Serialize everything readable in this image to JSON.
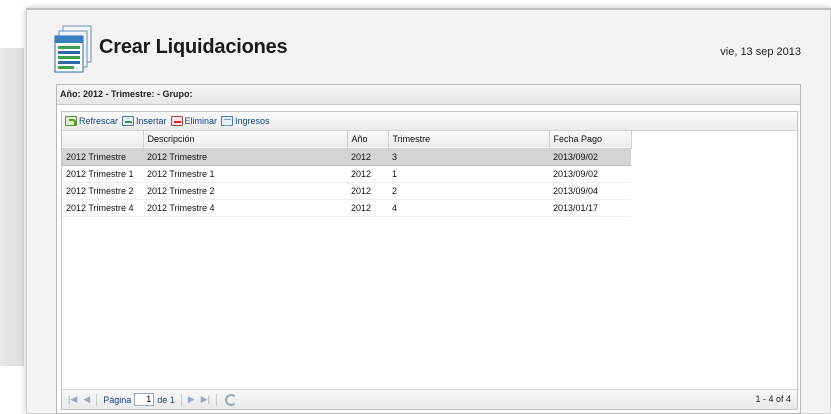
{
  "header": {
    "title": "Crear Liquidaciones",
    "date": "vie, 13 sep 2013"
  },
  "panel": {
    "title": "Año: 2012 - Trimestre: - Grupo:"
  },
  "toolbar": {
    "refresh_label": "Refrescar",
    "insert_label": "Insertar",
    "delete_label": "Eliminar",
    "income_label": "Ingresos"
  },
  "grid": {
    "columns": [
      "",
      "Descripción",
      "Año",
      "Trimestre",
      "Fecha Pago"
    ],
    "rows": [
      [
        "2012 Trimestre",
        "2012 Trimestre",
        "2012",
        "3",
        "2013/09/02"
      ],
      [
        "2012 Trimestre 1",
        "2012 Trimestre 1",
        "2012",
        "1",
        "2013/09/02"
      ],
      [
        "2012 Trimestre 2",
        "2012 Trimestre 2",
        "2012",
        "2",
        "2013/09/04"
      ],
      [
        "2012 Trimestre 4",
        "2012 Trimestre 4",
        "2012",
        "4",
        "2013/01/17"
      ]
    ]
  },
  "pager": {
    "page_label": "Página",
    "page_value": "1",
    "of_label": "de 1",
    "count": "1 - 4 of 4"
  },
  "colors": {
    "selected_row": "#d4d4d4",
    "link_blue": "#15428b"
  },
  "icons": {
    "app": "document-stack-icon",
    "refresh": "refresh-icon",
    "insert": "insert-row-icon",
    "delete": "delete-row-icon",
    "income": "table-icon"
  }
}
